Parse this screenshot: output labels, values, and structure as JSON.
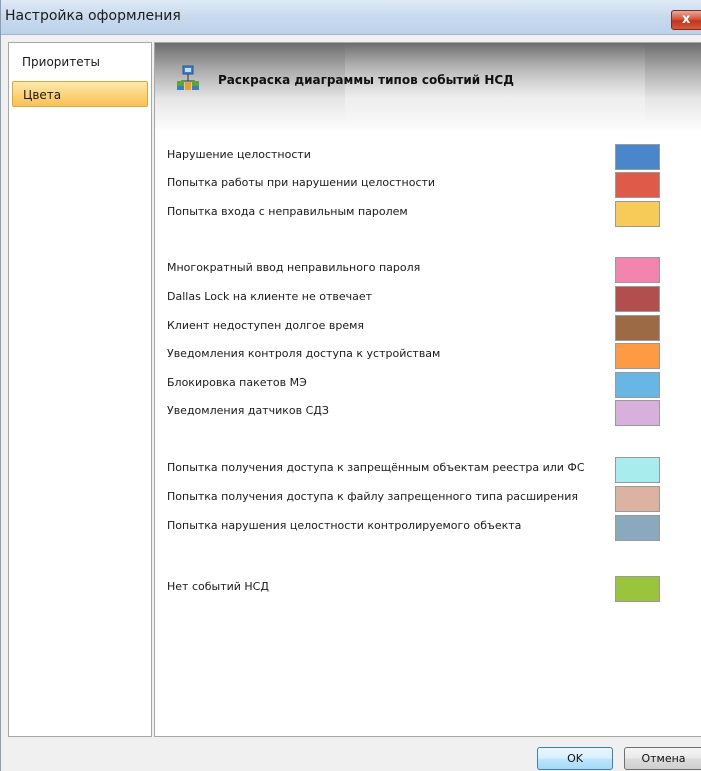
{
  "window": {
    "title": "Настройка оформления",
    "close_label": "x"
  },
  "sidebar": {
    "items": [
      {
        "label": "Приоритеты",
        "selected": false
      },
      {
        "label": "Цвета",
        "selected": true
      }
    ]
  },
  "header": {
    "title": "Раскраска диаграммы типов событий НСД",
    "icon": "network-diagram-icon"
  },
  "groups": [
    {
      "rows": [
        {
          "label": "Нарушение целостности",
          "color": "#4a86cc"
        },
        {
          "label": "Попытка работы при нарушении целостности",
          "color": "#e05a49"
        },
        {
          "label": "Попытка входа с неправильным паролем",
          "color": "#f6cb58"
        }
      ]
    },
    {
      "rows": [
        {
          "label": "Многократный ввод неправильного пароля",
          "color": "#f185ad"
        },
        {
          "label": "Dallas Lock на клиенте не отвечает",
          "color": "#b34e4e"
        },
        {
          "label": "Клиент недоступен долгое время",
          "color": "#9c6a44"
        },
        {
          "label": "Уведомления контроля доступа к устройствам",
          "color": "#fd9a43"
        },
        {
          "label": "Блокировка пакетов МЭ",
          "color": "#69b5e6"
        },
        {
          "label": "Уведомления датчиков СДЗ",
          "color": "#d7b1dc"
        }
      ]
    },
    {
      "rows": [
        {
          "label": "Попытка получения доступа к запрещённым объектам реестра или ФС",
          "color": "#a9ecee"
        },
        {
          "label": "Попытка получения доступа к файлу запрещенного типа расширения",
          "color": "#dcb3a2"
        },
        {
          "label": "Попытка нарушения целостности контролируемого объекта",
          "color": "#8aa9bf"
        }
      ]
    },
    {
      "rows": [
        {
          "label": "Нет событий НСД",
          "color": "#99c43b"
        }
      ]
    }
  ],
  "footer": {
    "ok_label": "OK",
    "cancel_label": "Отмена"
  }
}
